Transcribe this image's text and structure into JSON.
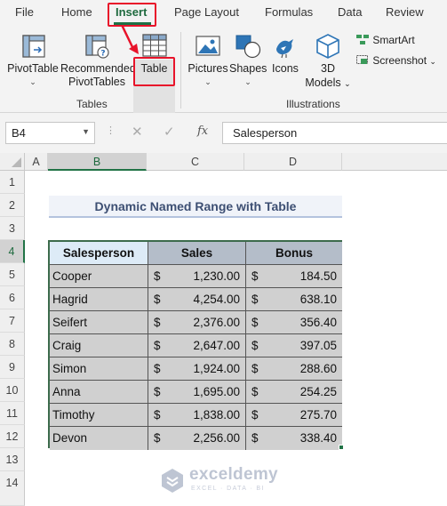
{
  "ribbon_tabs": [
    "File",
    "Home",
    "Insert",
    "Page Layout",
    "Formulas",
    "Data",
    "Review"
  ],
  "ribbon": {
    "pivottable": {
      "label": "PivotTable"
    },
    "recommended": {
      "label1": "Recommended",
      "label2": "PivotTables"
    },
    "table": {
      "label": "Table"
    },
    "pictures": {
      "label": "Pictures"
    },
    "shapes": {
      "label": "Shapes"
    },
    "icons": {
      "label": "Icons"
    },
    "models3d": {
      "label1": "3D",
      "label2": "Models"
    },
    "smartart": {
      "label": "SmartArt"
    },
    "screenshot": {
      "label": "Screenshot"
    },
    "group_tables": "Tables",
    "group_illustrations": "Illustrations"
  },
  "formula_bar": {
    "name_box": "B4",
    "fx": "fx",
    "content": "Salesperson"
  },
  "columns": [
    "A",
    "B",
    "C",
    "D"
  ],
  "rows": [
    "1",
    "2",
    "3",
    "4",
    "5",
    "6",
    "7",
    "8",
    "9",
    "10",
    "11",
    "12",
    "13",
    "14"
  ],
  "sheet": {
    "title": "Dynamic Named Range with Table",
    "headers": [
      "Salesperson",
      "Sales",
      "Bonus"
    ],
    "currency": "$",
    "data": [
      {
        "salesperson": "Cooper",
        "sales": "1,230.00",
        "bonus": "184.50"
      },
      {
        "salesperson": "Hagrid",
        "sales": "4,254.00",
        "bonus": "638.10"
      },
      {
        "salesperson": "Seifert",
        "sales": "2,376.00",
        "bonus": "356.40"
      },
      {
        "salesperson": "Craig",
        "sales": "2,647.00",
        "bonus": "397.05"
      },
      {
        "salesperson": "Simon",
        "sales": "1,924.00",
        "bonus": "288.60"
      },
      {
        "salesperson": "Anna",
        "sales": "1,695.00",
        "bonus": "254.25"
      },
      {
        "salesperson": "Timothy",
        "sales": "1,838.00",
        "bonus": "275.70"
      },
      {
        "salesperson": "Devon",
        "sales": "2,256.00",
        "bonus": "338.40"
      }
    ]
  },
  "watermark": {
    "name": "exceldemy",
    "tagline": "EXCEL · DATA · BI"
  },
  "colors": {
    "excel_green": "#217346",
    "highlight_red": "#e8132a",
    "header_blue": "#ddebf7",
    "header_gray": "#b4bdc9",
    "data_gray": "#d0d0d0"
  }
}
